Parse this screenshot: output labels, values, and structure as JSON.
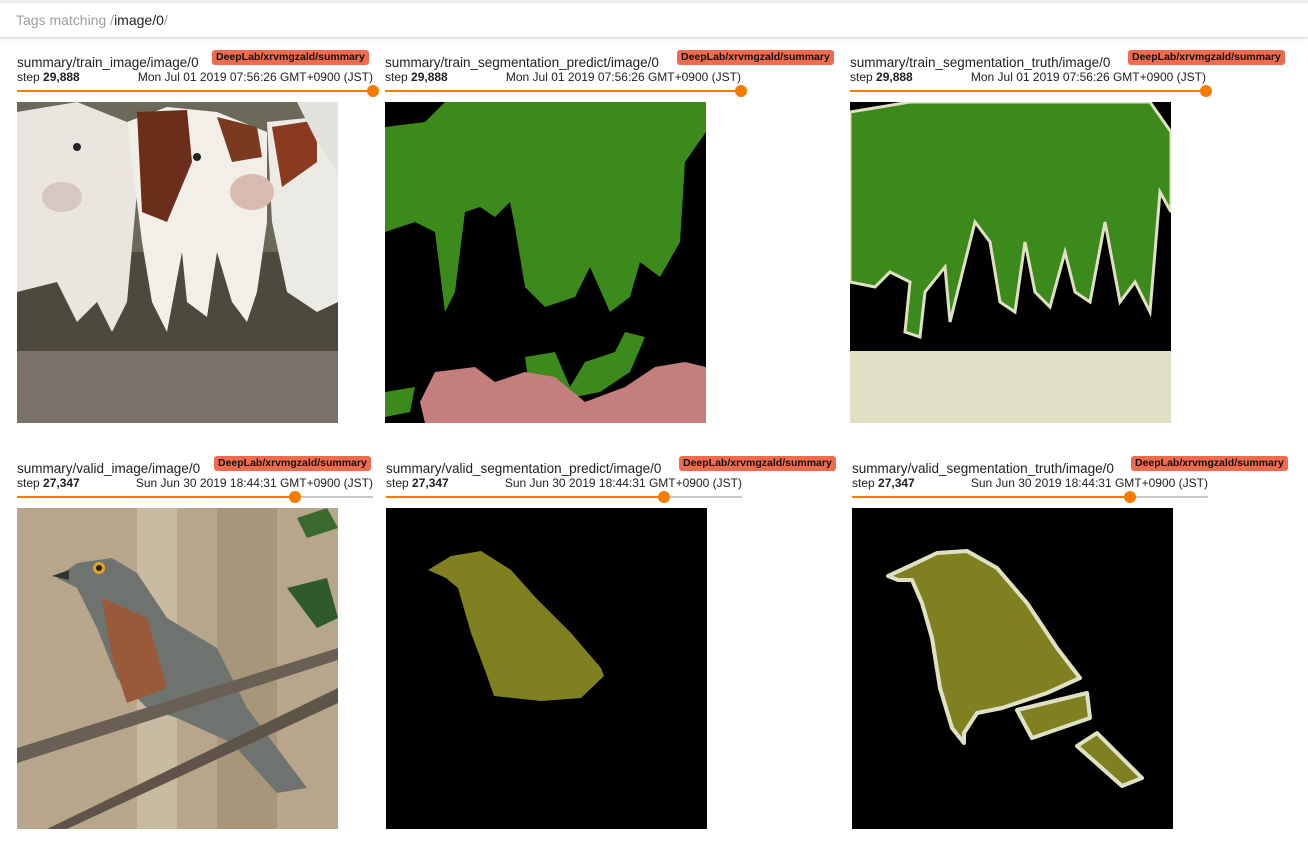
{
  "search": {
    "prefix": "Tags matching ",
    "slash_open": "/",
    "query": "image/0",
    "slash_close": "/"
  },
  "cards": [
    {
      "tag": "summary/train_image/image/0",
      "run": "DeepLab/xrvmgzald/summary",
      "step_prefix": "step ",
      "step": "29,888",
      "time": "Mon Jul 01 2019 07:56:26 GMT+0900 (JST)",
      "slider_value": 1.0,
      "image": "cows-photo"
    },
    {
      "tag": "summary/train_segmentation_predict/image/0",
      "run": "DeepLab/xrvmgzald/summary",
      "step_prefix": "step ",
      "step": "29,888",
      "time": "Mon Jul 01 2019 07:56:26 GMT+0900 (JST)",
      "slider_value": 1.0,
      "image": "cows-predicted-mask"
    },
    {
      "tag": "summary/train_segmentation_truth/image/0",
      "run": "DeepLab/xrvmgzald/summary",
      "step_prefix": "step ",
      "step": "29,888",
      "time": "Mon Jul 01 2019 07:56:26 GMT+0900 (JST)",
      "slider_value": 1.0,
      "image": "cows-truth-mask"
    },
    {
      "tag": "summary/valid_image/image/0",
      "run": "DeepLab/xrvmgzald/summary",
      "step_prefix": "step ",
      "step": "27,347",
      "time": "Sun Jun 30 2019 18:44:31 GMT+0900 (JST)",
      "slider_value": 0.78,
      "image": "bird-photo"
    },
    {
      "tag": "summary/valid_segmentation_predict/image/0",
      "run": "DeepLab/xrvmgzald/summary",
      "step_prefix": "step ",
      "step": "27,347",
      "time": "Sun Jun 30 2019 18:44:31 GMT+0900 (JST)",
      "slider_value": 0.78,
      "image": "bird-predicted-mask"
    },
    {
      "tag": "summary/valid_segmentation_truth/image/0",
      "run": "DeepLab/xrvmgzald/summary",
      "step_prefix": "step ",
      "step": "27,347",
      "time": "Sun Jun 30 2019 18:44:31 GMT+0900 (JST)",
      "slider_value": 0.78,
      "image": "bird-truth-mask"
    }
  ],
  "colors": {
    "badge": "#ef6b4d",
    "slider": "#f57c00",
    "cow_class": "#3c8a1b",
    "person_class": "#c47e7e",
    "bird_class": "#808020",
    "void_border": "#e0e0c4"
  }
}
